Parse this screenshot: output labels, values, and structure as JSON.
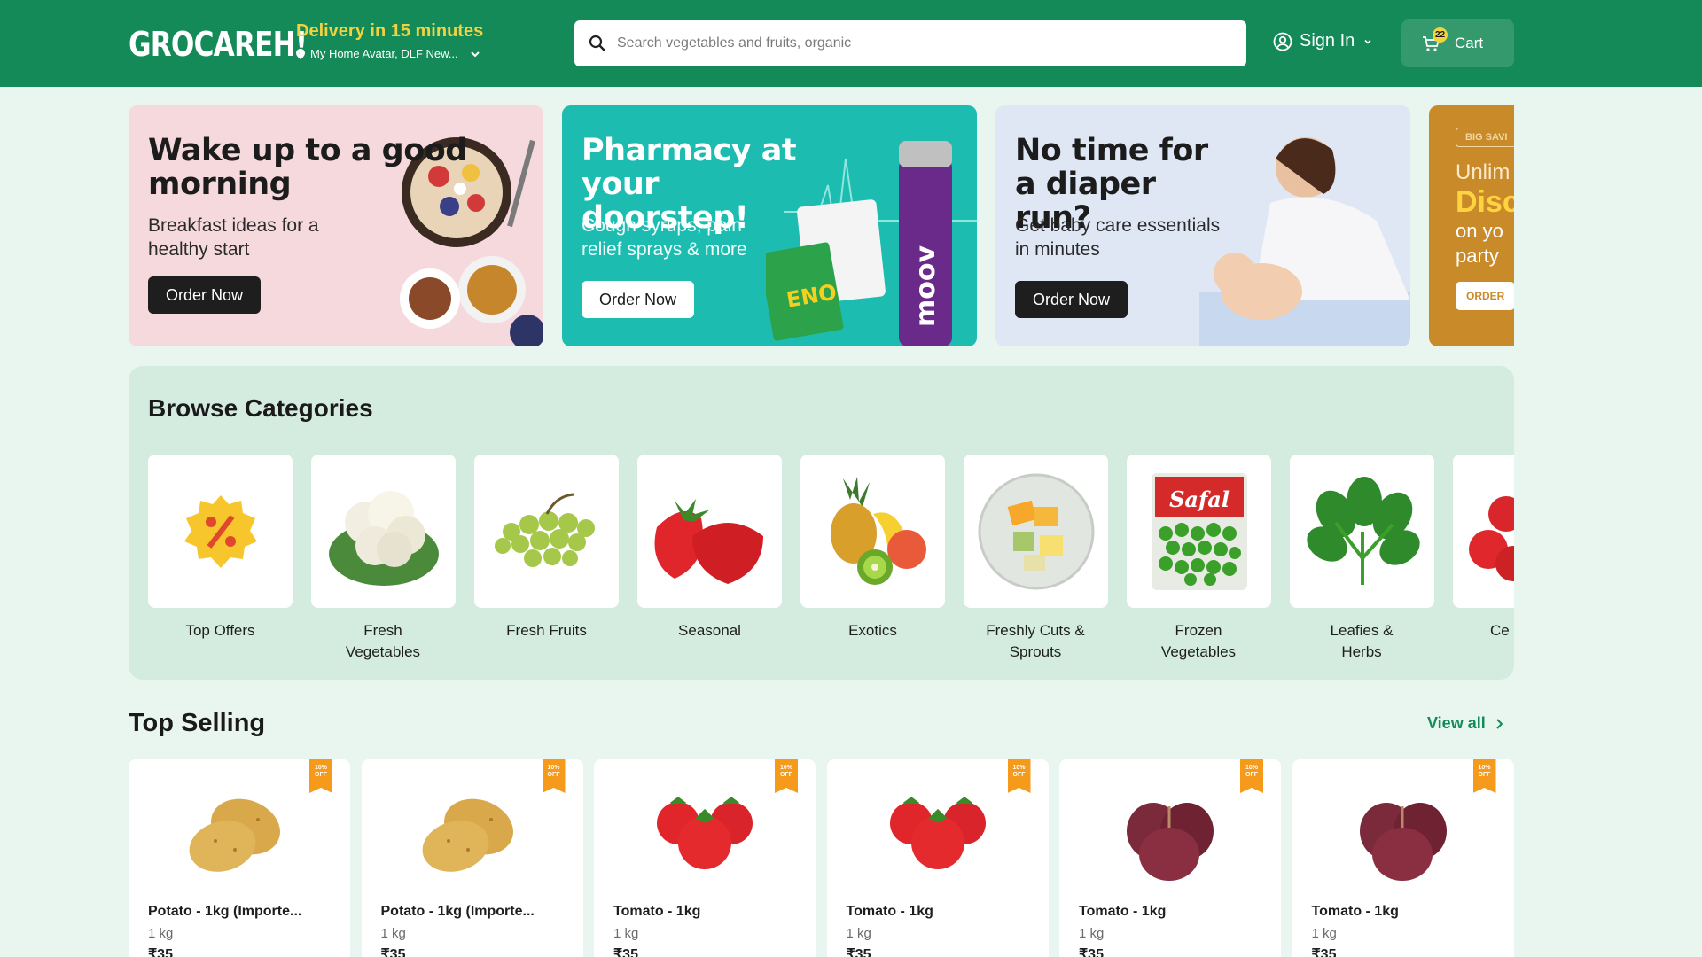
{
  "header": {
    "logo": "GROCAREH!",
    "delivery_title": "Delivery in 15 minutes",
    "location": "My Home Avatar, DLF New...",
    "search_placeholder": "Search vegetables and fruits, organic",
    "signin_label": "Sign In",
    "cart_label": "Cart",
    "cart_count": "22"
  },
  "banners": [
    {
      "title": "Wake up to a good morning",
      "subtitle": "Breakfast ideas for a healthy start",
      "button": "Order Now"
    },
    {
      "title": "Pharmacy at your doorstep!",
      "subtitle": "Cough syrups, pain relief sprays & more",
      "button": "Order Now"
    },
    {
      "title": "No time for a diaper run?",
      "subtitle": "Get baby care essentials in minutes",
      "button": "Order Now"
    },
    {
      "tag": "BIG SAVI",
      "line1": "Unlim",
      "line2": "Disc",
      "line3": "on yo",
      "line4": "party",
      "button": "ORDER"
    }
  ],
  "categories": {
    "title": "Browse Categories",
    "items": [
      {
        "label": "Top Offers"
      },
      {
        "label": "Fresh Vegetables"
      },
      {
        "label": "Fresh Fruits"
      },
      {
        "label": "Seasonal"
      },
      {
        "label": "Exotics"
      },
      {
        "label": "Freshly Cuts & Sprouts"
      },
      {
        "label": "Frozen Vegetables"
      },
      {
        "label": "Leafies & Herbs"
      },
      {
        "label": "Ce Or"
      }
    ],
    "safal_label": "Safal"
  },
  "top_selling": {
    "title": "Top Selling",
    "view_all": "View all",
    "products": [
      {
        "name": "Potato - 1kg (Importe...",
        "qty": "1 kg",
        "price": "₹35",
        "discount": "10% OFF",
        "icon": "potato"
      },
      {
        "name": "Potato - 1kg (Importe...",
        "qty": "1 kg",
        "price": "₹35",
        "discount": "10% OFF",
        "icon": "potato"
      },
      {
        "name": "Tomato - 1kg",
        "qty": "1 kg",
        "price": "₹35",
        "discount": "10% OFF",
        "icon": "tomato"
      },
      {
        "name": "Tomato - 1kg",
        "qty": "1 kg",
        "price": "₹35",
        "discount": "10% OFF",
        "icon": "tomato"
      },
      {
        "name": "Tomato - 1kg",
        "qty": "1 kg",
        "price": "₹35",
        "discount": "10% OFF",
        "icon": "onion"
      },
      {
        "name": "Tomato - 1kg",
        "qty": "1 kg",
        "price": "₹35",
        "discount": "10% OFF",
        "icon": "onion"
      }
    ]
  },
  "colors": {
    "brand": "#138a57",
    "accent": "#f3d23f",
    "discount": "#f59a1b"
  }
}
